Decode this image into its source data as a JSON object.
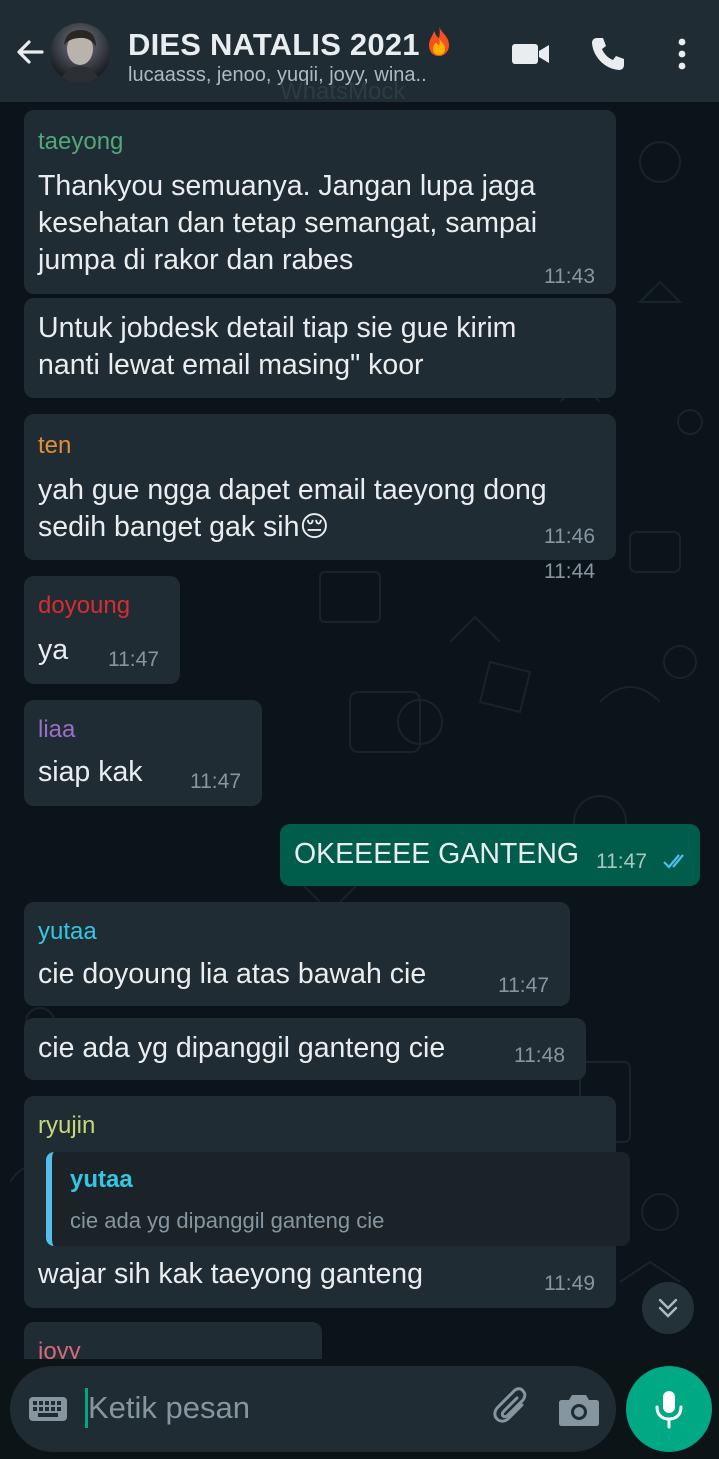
{
  "header": {
    "title": "DIES NATALIS 2021",
    "subtitle": "lucaasss, jenoo, yuqii, joyy, wina..",
    "watermark": "WhatsMock"
  },
  "messages": [
    {
      "sender": "taeyong",
      "sender_color": "#53a77b",
      "text": "Thankyou semuanya. Jangan lupa jaga\nkesehatan dan tetap semangat, sampai\njumpa di rakor dan rabes",
      "time": "11:43"
    },
    {
      "sender": "",
      "text": "Untuk jobdesk detail tiap sie gue kirim\nnanti lewat email masing\" koor",
      "time": "11:44"
    },
    {
      "sender": "ten",
      "sender_color": "#e08f38",
      "text": "yah gue ngga dapet email taeyong dong\nsedih banget gak sih",
      "emoji": "😔",
      "time": "11:46"
    },
    {
      "sender": "doyoung",
      "sender_color": "#d72c31",
      "text": "ya",
      "time": "11:47"
    },
    {
      "sender": "liaa",
      "sender_color": "#9a6fc7",
      "text": "siap kak",
      "time": "11:47"
    },
    {
      "sender": "",
      "outgoing": true,
      "text": "OKEEEEE GANTENG",
      "time": "11:47"
    },
    {
      "sender": "yutaa",
      "sender_color": "#35c6e3",
      "text": "cie doyoung lia atas bawah cie",
      "time": "11:47"
    },
    {
      "sender": "",
      "text": "cie ada yg dipanggil ganteng cie",
      "time": "11:48"
    },
    {
      "sender": "ryujin",
      "sender_color": "#c6d97a",
      "text": "wajar sih kak taeyong ganteng",
      "time": "11:49",
      "quote": {
        "sender": "yutaa",
        "sender_color": "#35c6e3",
        "text": "cie ada yg dipanggil ganteng cie"
      }
    },
    {
      "sender": "joyy",
      "sender_color": "#d36a7b",
      "text": "",
      "time": ""
    }
  ],
  "input": {
    "placeholder": "Ketik pesan"
  },
  "icons": {
    "back": "arrow-left-icon",
    "video": "video-call-icon",
    "call": "phone-icon",
    "menu": "more-vert-icon",
    "keyboard": "keyboard-icon",
    "attach": "paperclip-icon",
    "camera": "camera-icon",
    "mic": "mic-icon",
    "scroll": "double-chevron-down-icon",
    "read": "double-check-icon"
  },
  "colors": {
    "header": "#1f2c33",
    "incoming": "#202c33",
    "outgoing": "#005c4b",
    "accent": "#00a884",
    "read_tick": "#53bdeb"
  }
}
